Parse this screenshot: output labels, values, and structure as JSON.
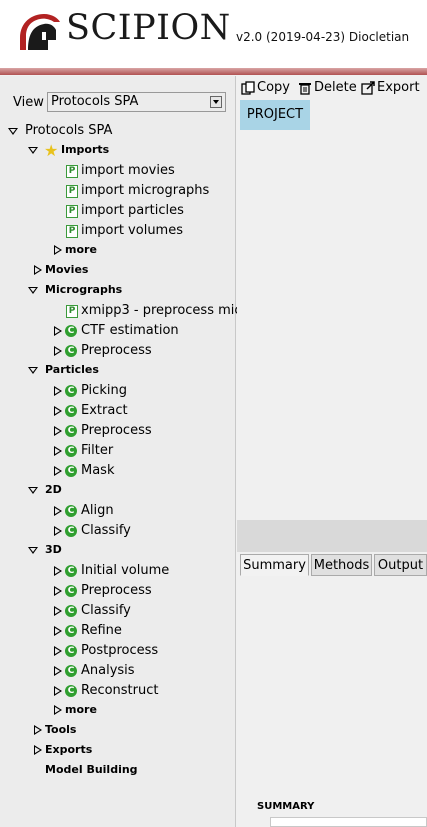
{
  "header": {
    "logo_text": "SCIPION",
    "version": "v2.0 (2019-04-23) Diocletian"
  },
  "view": {
    "label": "View",
    "selected": "Protocols SPA"
  },
  "toolbar": {
    "copy": "Copy",
    "delete": "Delete",
    "export": "Export"
  },
  "project_tab": "PROJECT",
  "tree": {
    "root": "Protocols SPA",
    "imports": {
      "label": "Imports",
      "items": [
        "import movies",
        "import micrographs",
        "import particles",
        "import volumes"
      ],
      "more": "more"
    },
    "movies": "Movies",
    "micrographs": {
      "label": "Micrographs",
      "items": [
        "xmipp3 - preprocess mic",
        "CTF estimation",
        "Preprocess"
      ]
    },
    "particles": {
      "label": "Particles",
      "items": [
        "Picking",
        "Extract",
        "Preprocess",
        "Filter",
        "Mask"
      ]
    },
    "twod": {
      "label": "2D",
      "items": [
        "Align",
        "Classify"
      ]
    },
    "threed": {
      "label": "3D",
      "items": [
        "Initial volume",
        "Preprocess",
        "Classify",
        "Refine",
        "Postprocess",
        "Analysis",
        "Reconstruct"
      ],
      "more": "more"
    },
    "tools": "Tools",
    "exports": "Exports",
    "model_building": "Model Building"
  },
  "info_tabs": [
    "Summary",
    "Methods",
    "Output"
  ],
  "summary_label": "SUMMARY",
  "colors": {
    "stripe": "#b05252",
    "project_tab": "#a9d4e6",
    "protocol_icon": "#2f9e2f"
  }
}
